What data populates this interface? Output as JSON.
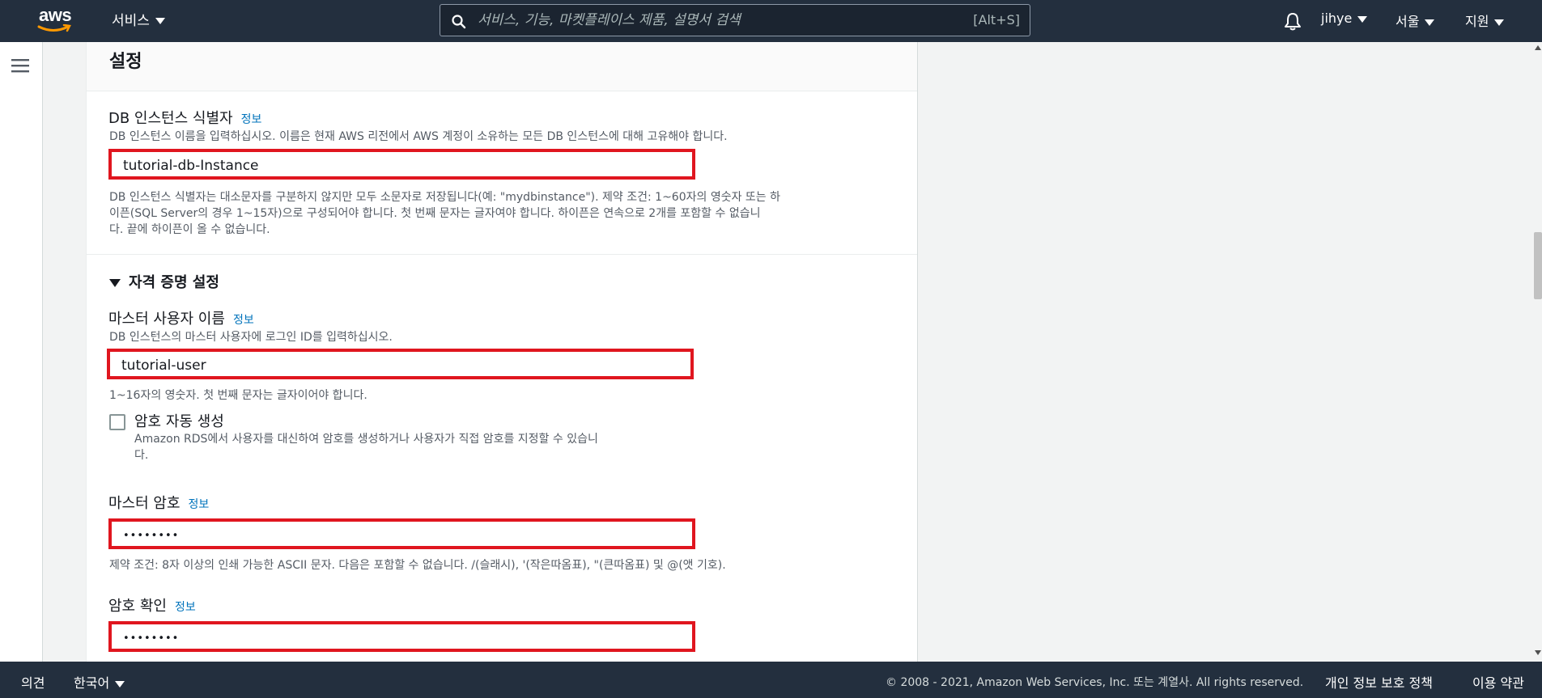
{
  "topnav": {
    "logo_text": "aws",
    "services_label": "서비스",
    "search_placeholder": "서비스, 기능, 마켓플레이스 제품, 설명서 검색",
    "search_shortcut": "[Alt+S]",
    "user_label": "jihye",
    "region_label": "서울",
    "support_label": "지원"
  },
  "panel": {
    "title": "설정",
    "db_identifier": {
      "label": "DB 인스턴스 식별자",
      "info": "정보",
      "description": "DB 인스턴스 이름을 입력하십시오. 이름은 현재 AWS 리전에서 AWS 계정이 소유하는 모든 DB 인스턴스에 대해 고유해야 합니다.",
      "value": "tutorial-db-Instance",
      "constraint_line1": "DB 인스턴스 식별자는 대소문자를 구분하지 않지만 모두 소문자로 저장됩니다(예: \"mydbinstance\"). 제약 조건: 1~60자의 영숫자 또는 하",
      "constraint_line2": "이픈(SQL Server의 경우 1~15자)으로 구성되어야 합니다. 첫 번째 문자는 글자여야 합니다. 하이픈은 연속으로 2개를 포함할 수 없습니",
      "constraint_line3": "다. 끝에 하이픈이 올 수 없습니다."
    },
    "credentials": {
      "section_title": "자격 증명 설정",
      "master_username": {
        "label": "마스터 사용자 이름",
        "info": "정보",
        "description": "DB 인스턴스의 마스터 사용자에 로그인 ID를 입력하십시오.",
        "value": "tutorial-user",
        "constraint": "1~16자의 영숫자. 첫 번째 문자는 글자이어야 합니다."
      },
      "auto_password": {
        "label": "암호 자동 생성",
        "description_line1": "Amazon RDS에서 사용자를 대신하여 암호를 생성하거나 사용자가 직접 암호를 지정할 수 있습니",
        "description_line2": "다.",
        "checked": false
      },
      "master_password": {
        "label": "마스터 암호",
        "info": "정보",
        "value": "••••••••",
        "constraint": "제약 조건: 8자 이상의 인쇄 가능한 ASCII 문자. 다음은 포함할 수 없습니다. /(슬래시), '(작은따옴표), \"(큰따옴표) 및 @(앳 기호)."
      },
      "confirm_password": {
        "label": "암호 확인",
        "info": "정보",
        "value": "••••••••"
      }
    }
  },
  "footer": {
    "feedback": "의견",
    "language": "한국어",
    "copyright": "© 2008 - 2021, Amazon Web Services, Inc. 또는 계열사. All rights reserved.",
    "privacy": "개인 정보 보호 정책",
    "terms": "이용 약관"
  },
  "colors": {
    "nav_bg": "#232f3e",
    "highlight_border": "#e0161f",
    "link": "#0073bb"
  }
}
